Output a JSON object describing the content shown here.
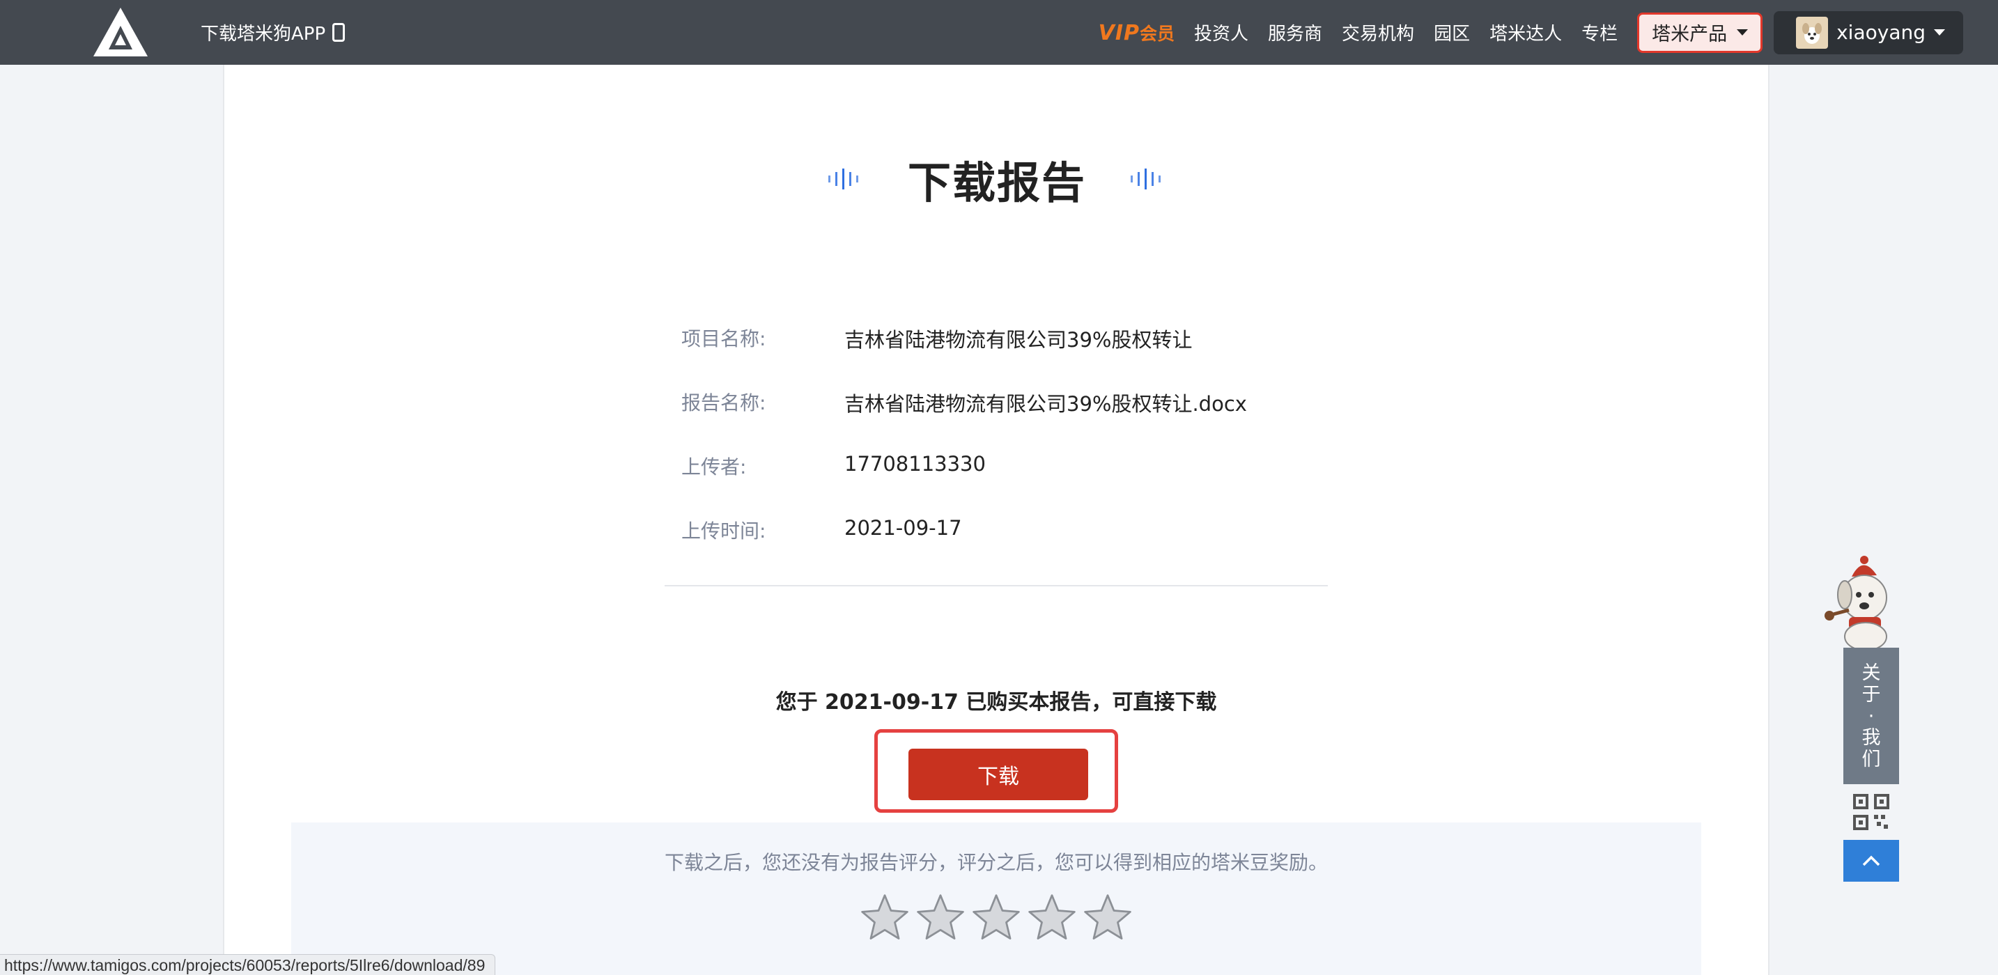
{
  "header": {
    "app_download": "下载塔米狗APP",
    "vip": {
      "mark": "VIP",
      "text": "会员"
    },
    "nav_links": [
      "投资人",
      "服务商",
      "交易机构",
      "园区",
      "塔米达人",
      "专栏"
    ],
    "product_menu": "塔米产品",
    "username": "xiaoyang"
  },
  "main": {
    "title": "下载报告",
    "info": [
      {
        "label": "项目名称:",
        "value": "吉林省陆港物流有限公司39%股权转让"
      },
      {
        "label": "报告名称:",
        "value": "吉林省陆港物流有限公司39%股权转让.docx"
      },
      {
        "label": "上传者:",
        "value": "17708113330"
      },
      {
        "label": "上传时间:",
        "value": "2021-09-17"
      }
    ],
    "purchase_note": "您于 2021-09-17 已购买本报告，可直接下载",
    "download_label": "下载",
    "rating_hint": "下载之后，您还没有为报告评分，评分之后，您可以得到相应的塔米豆奖励。",
    "rating_stars": 5,
    "rating_value": 0
  },
  "sidebar_widget": {
    "about_chars": [
      "关",
      "于",
      "·",
      "我",
      "们"
    ]
  },
  "status_url": "https://www.tamigos.com/projects/60053/reports/5Ilre6/download/89",
  "colors": {
    "topbar": "#444950",
    "vip": "#f0781e",
    "download_button": "#c8321f",
    "highlight_frame": "#e54140",
    "accent_blue": "#2f7fd8"
  }
}
